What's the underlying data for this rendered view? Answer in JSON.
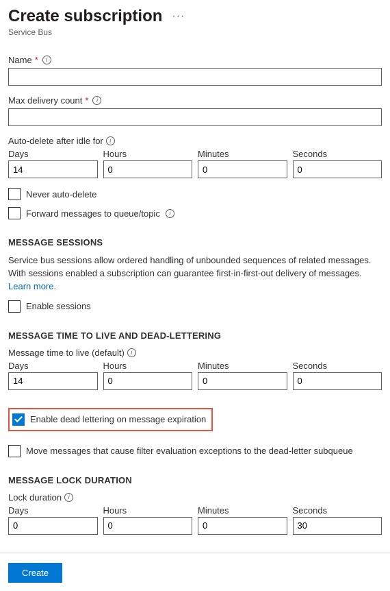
{
  "header": {
    "title": "Create subscription",
    "subtitle": "Service Bus"
  },
  "fields": {
    "name_label": "Name",
    "name_value": "",
    "max_delivery_label": "Max delivery count",
    "max_delivery_value": ""
  },
  "autoDelete": {
    "label": "Auto-delete after idle for",
    "days_label": "Days",
    "hours_label": "Hours",
    "minutes_label": "Minutes",
    "seconds_label": "Seconds",
    "days": "14",
    "hours": "0",
    "minutes": "0",
    "seconds": "0",
    "never_label": "Never auto-delete"
  },
  "forward": {
    "label": "Forward messages to queue/topic"
  },
  "sessions": {
    "header": "MESSAGE SESSIONS",
    "desc": "Service bus sessions allow ordered handling of unbounded sequences of related messages. With sessions enabled a subscription can guarantee first-in-first-out delivery of messages.",
    "learn_more": "Learn more.",
    "enable_label": "Enable sessions"
  },
  "ttl": {
    "header": "MESSAGE TIME TO LIVE AND DEAD-LETTERING",
    "label": "Message time to live (default)",
    "days": "14",
    "hours": "0",
    "minutes": "0",
    "seconds": "0",
    "dead_letter_label": "Enable dead lettering on message expiration",
    "move_exceptions_label": "Move messages that cause filter evaluation exceptions to the dead-letter subqueue"
  },
  "lock": {
    "header": "MESSAGE LOCK DURATION",
    "label": "Lock duration",
    "days": "0",
    "hours": "0",
    "minutes": "0",
    "seconds": "30"
  },
  "footer": {
    "create": "Create"
  }
}
